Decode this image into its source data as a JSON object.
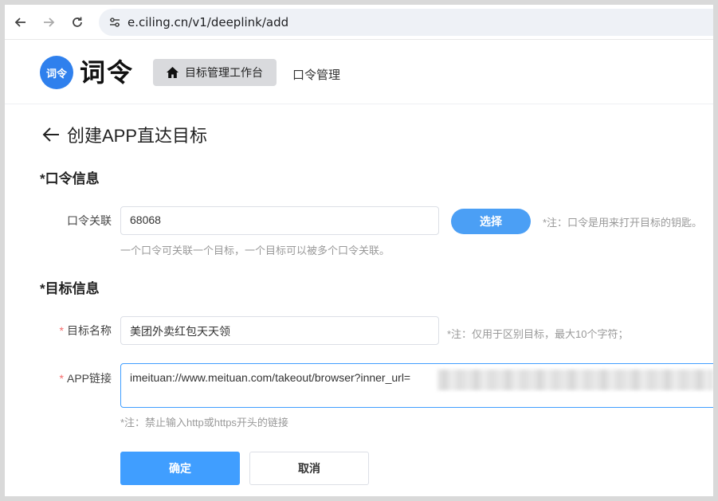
{
  "browser": {
    "url": "e.ciling.cn/v1/deeplink/add",
    "back_icon": "arrow-left-icon",
    "forward_icon": "arrow-right-icon",
    "reload_icon": "reload-icon",
    "site_info_icon": "tune-icon"
  },
  "header": {
    "logo_badge": "词令",
    "logo_text": "词令",
    "nav_active_label": "目标管理工作台",
    "nav_active_icon": "home-icon",
    "nav_item_label": "口令管理"
  },
  "page": {
    "title": "创建APP直达目标"
  },
  "section_command": {
    "title": "*口令信息",
    "link_label": "口令关联",
    "link_value": "68068",
    "select_button": "选择",
    "note": "*注：口令是用来打开目标的钥匙。",
    "help": "一个口令可关联一个目标，一个目标可以被多个口令关联。"
  },
  "section_target": {
    "title": "*目标信息",
    "name_label": "目标名称",
    "name_value": "美团外卖红包天天领",
    "name_note": "*注：仅用于区别目标，最大10个字符；",
    "link_label": "APP链接",
    "link_value": "imeituan://www.meituan.com/takeout/browser?inner_url=",
    "link_note": "*注：禁止输入http或https开头的链接",
    "required_mark": "*"
  },
  "actions": {
    "confirm": "确定",
    "cancel": "取消"
  },
  "colors": {
    "primary": "#409eff",
    "select_button": "#4b9ff5",
    "logo": "#2f80ed",
    "required": "#f56c6c"
  }
}
